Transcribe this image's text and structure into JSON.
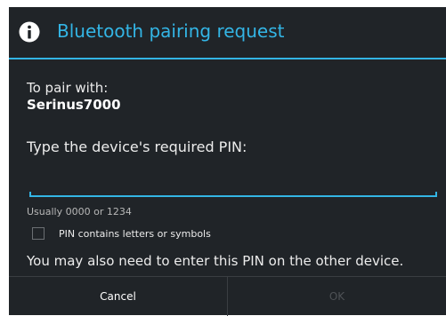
{
  "dialog": {
    "title": "Bluetooth pairing request",
    "title_icon": "info-icon",
    "accent_color": "#33b5e5",
    "pair_label": "To pair with:",
    "device_name": "Serinus7000",
    "pin_prompt": "Type the device's required PIN:",
    "pin_value": "",
    "pin_hint": "Usually 0000 or 1234",
    "checkbox_label": "PIN contains letters or symbols",
    "checkbox_checked": false,
    "note": "You may also need to enter this PIN on the other device."
  },
  "buttons": {
    "cancel_label": "Cancel",
    "ok_label": "OK",
    "ok_enabled": false
  }
}
